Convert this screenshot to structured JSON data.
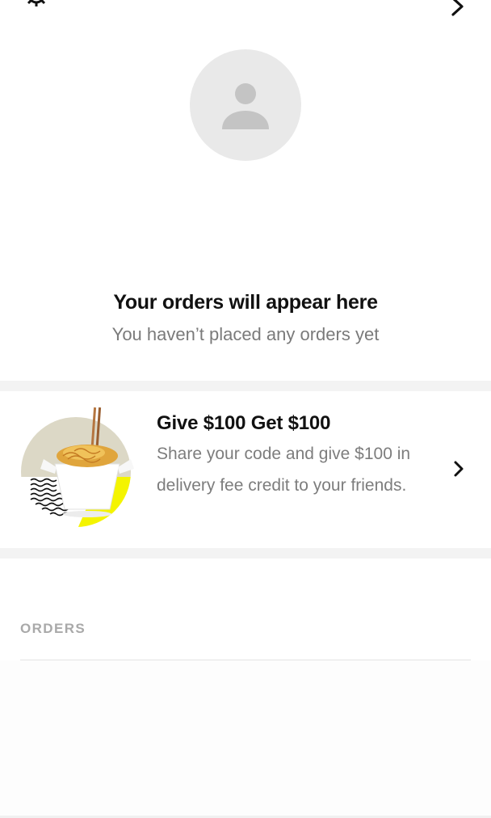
{
  "header": {
    "settings_icon": "gear-icon",
    "forward_icon": "chevron-right-icon"
  },
  "profile": {
    "avatar_icon": "person-icon",
    "avatar_color": "#e9e9e9"
  },
  "empty_state": {
    "title": "Your orders will appear here",
    "subtitle": "You haven’t placed any orders yet"
  },
  "promo": {
    "title": "Give $100 Get $100",
    "body": "Share your code and give $100 in delivery fee credit to your friends.",
    "image_icon": "noodle-box-illustration",
    "accent_color": "#f4f400",
    "chevron_icon": "chevron-right-icon"
  },
  "orders_section": {
    "header": "ORDERS"
  }
}
